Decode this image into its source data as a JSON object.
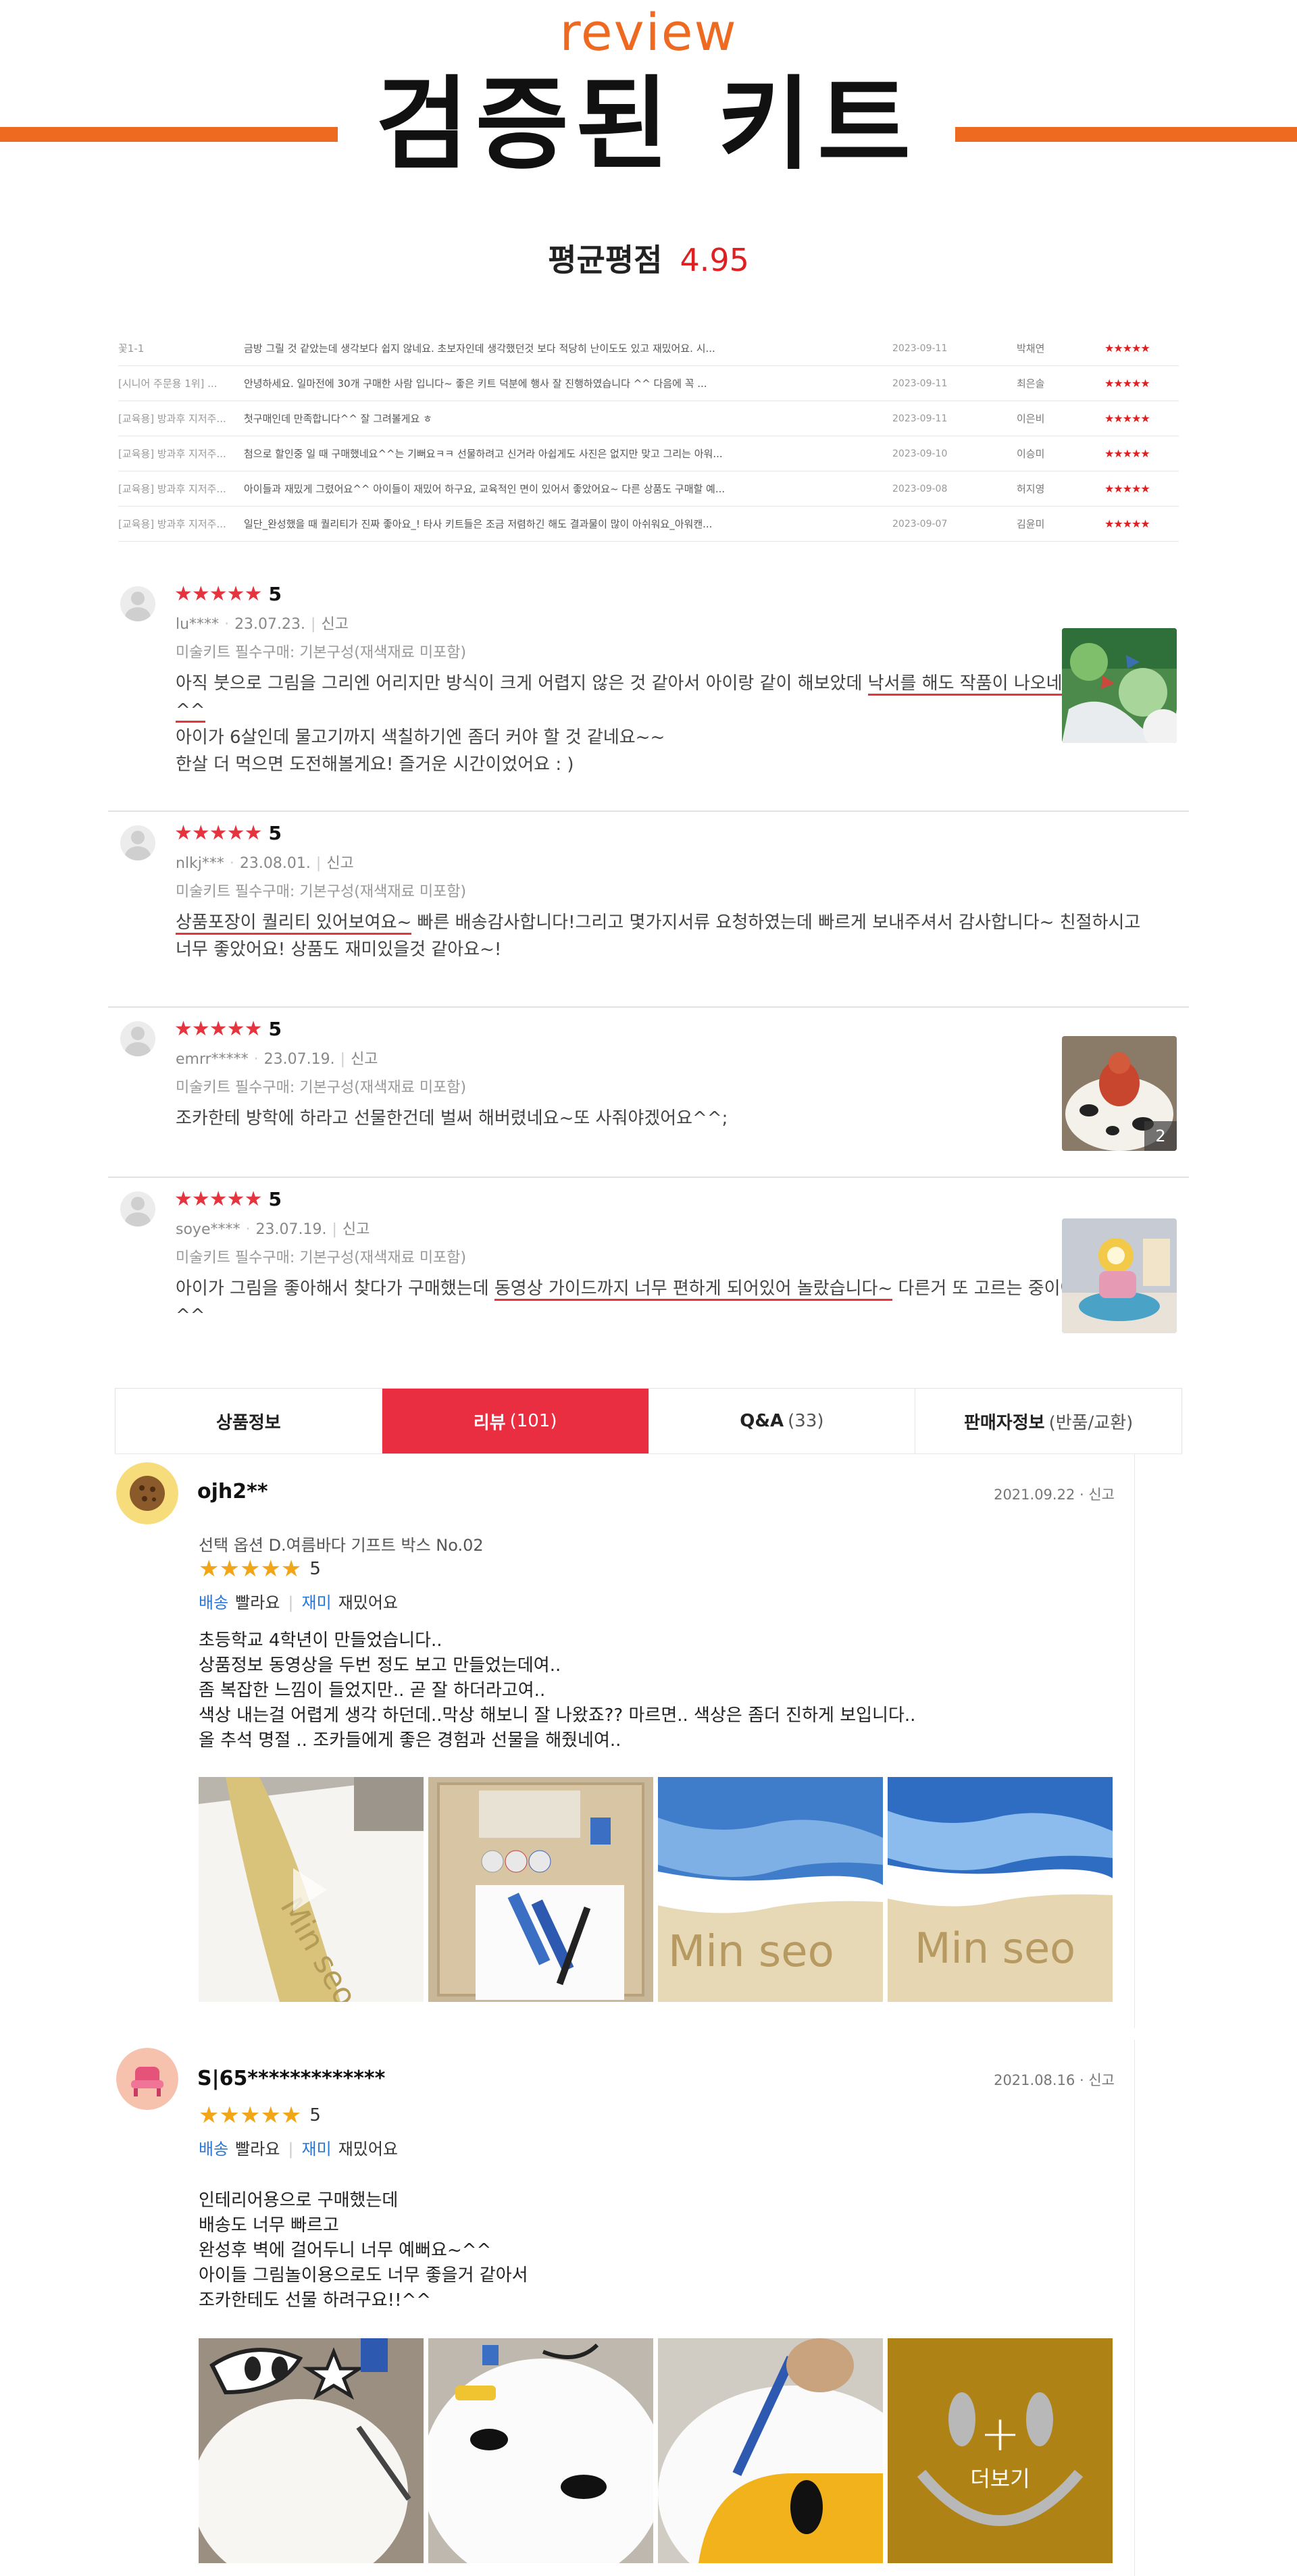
{
  "hero": {
    "eyebrow": "review",
    "title": "검증된 키트",
    "avg_label": "평균평점",
    "avg_score": "4.95"
  },
  "mini_reviews": [
    {
      "option": "꽃1-1",
      "text": "금방 그릴 것 같았는데 생각보다 쉽지 않네요. 초보자인데 생각했던것 보다 적당히 난이도도 있고 재밌어요. 시...",
      "date": "2023-09-11",
      "author": "박채연",
      "stars": "★★★★★"
    },
    {
      "option": "[시니어 주문용 1위] ...",
      "text": "안녕하세요. 일마전에 30개 구매한 사람 입니다~ 좋은 키트 덕분에 행사 잘 진행하였습니다 ^^ 다음에 꼭 ...",
      "date": "2023-09-11",
      "author": "최은솔",
      "stars": "★★★★★"
    },
    {
      "option": "[교육용] 방과후 지저주...",
      "text": "첫구매인데 만족합니다^^ 잘 그려볼게요 ㅎ",
      "date": "2023-09-11",
      "author": "이은비",
      "stars": "★★★★★"
    },
    {
      "option": "[교육용] 방과후 지저주...",
      "text": "첨으로 할인중 일 때 구매했네요^^는 기뻐요ㅋㅋ 선물하려고 신거라 아쉽게도 사진은 없지만 맞고 그리는 아워...",
      "date": "2023-09-10",
      "author": "이승미",
      "stars": "★★★★★"
    },
    {
      "option": "[교육용] 방과후 지저주...",
      "text": "아이들과 재밌게 그렸어요^^ 아이들이 재밌어 하구요, 교육적인 면이 있어서 좋았어요~ 다른 상품도 구매할 예...",
      "date": "2023-09-08",
      "author": "허지영",
      "stars": "★★★★★"
    },
    {
      "option": "[교육용] 방과후 지저주...",
      "text": "일단_완성했을 때 퀄리티가 진짜 좋아요_! 타사 키트들은 조금 저렴하긴 해도 결과물이 많이 아쉬워요_아워캔...",
      "date": "2023-09-07",
      "author": "김윤미",
      "stars": "★★★★★"
    }
  ],
  "reviews_a": [
    {
      "stars": "★★★★★",
      "score": "5",
      "user": "lu****",
      "date": "23.07.23.",
      "report": "신고",
      "option": "미술키트 필수구매: 기본구성(재색재료 미포함)",
      "pre": "아직 붓으로 그림을 그리엔 어리지만 방식이 크게 어렵지 않은 것 같아서 아이랑 같이 해보았데 ",
      "hl": "낙서를 해도 작품이 나오네요 ^^",
      "post": "",
      "lines": [
        "아이가 6살인데 물고기까지 색칠하기엔 좀더 커야 할 것 같네요~~",
        "한살 더 먹으면 도전해볼게요! 즐거운 시간이었어요 : )"
      ]
    },
    {
      "stars": "★★★★★",
      "score": "5",
      "user": "nlkj***",
      "date": "23.08.01.",
      "report": "신고",
      "option": "미술키트 필수구매: 기본구성(재색재료 미포함)",
      "pre": "",
      "hl": "상품포장이 퀄리티 있어보여요~",
      "post": " 빠른 배송감사합니다!그리고 몇가지서류 요청하였는데 빠르게 보내주셔서 감사합니다~ 친절하시고 너무 좋았어요! 상품도 재미있을것 같아요~!",
      "lines": []
    },
    {
      "stars": "★★★★★",
      "score": "5",
      "user": "emrr*****",
      "date": "23.07.19.",
      "report": "신고",
      "option": "미술키트 필수구매: 기본구성(재색재료 미포함)",
      "pre": "조카한테 방학에 하라고 선물한건데 벌써 해버렸네요~또 사줘야겠어요^^;",
      "hl": "",
      "post": "",
      "lines": [],
      "photo_count": "2"
    },
    {
      "stars": "★★★★★",
      "score": "5",
      "user": "soye****",
      "date": "23.07.19.",
      "report": "신고",
      "option": "미술키트 필수구매: 기본구성(재색재료 미포함)",
      "pre": "아이가 그림을 좋아해서 찾다가 구매했는데 ",
      "hl": "동영상 가이드까지 너무 편하게 되어있어 놀랐습니다~",
      "post": " 다른거 또 고르는 중이에요^^",
      "lines": []
    }
  ],
  "tabs": [
    {
      "label": "상품정보",
      "count": ""
    },
    {
      "label": "리뷰",
      "count": "(101)"
    },
    {
      "label": "Q&A",
      "count": "(33)"
    },
    {
      "label": "판매자정보",
      "count": "(반품/교환)"
    }
  ],
  "reviews_b": [
    {
      "user": "ojh2**",
      "date": "2021.09.22",
      "report": "신고",
      "option": "선택 옵션 D.여름바다 기프트 박스 No.02",
      "stars": "★★★★★",
      "score": "5",
      "tag1_key": "배송",
      "tag1_val": "빨라요",
      "tag2_key": "재미",
      "tag2_val": "재밌어요",
      "lines": [
        "초등학교 4학년이 만들었습니다..",
        "상품정보 동영상을 두번 정도 보고 만들었는데여..",
        "좀 복잡한 느낌이 들었지만.. 곧 잘 하더라고여..",
        "색상 내는걸 어렵게 생각 하던데..막상 해보니 잘 나왔죠?? 마르면.. 색상은 좀더 진하게 보입니다..",
        "올 추석 명절 .. 조카들에게 좋은 경험과 선물을 해줬네여.."
      ]
    },
    {
      "user": "S|65*************",
      "date": "2021.08.16",
      "report": "신고",
      "option": "",
      "stars": "★★★★★",
      "score": "5",
      "tag1_key": "배송",
      "tag1_val": "빨라요",
      "tag2_key": "재미",
      "tag2_val": "재밌어요",
      "lines": [
        "인테리어용으로 구매했는데",
        "배송도 너무 빠르고",
        "완성후 벽에 걸어두니 너무 예뻐요~^^",
        "아이들 그림놀이용으로도 너무 좋을거 같아서",
        "조카한테도 선물 하려구요!!^^"
      ],
      "more_label": "더보기"
    }
  ],
  "colors": {
    "accent_orange": "#ee6a20",
    "accent_red": "#e5343e",
    "tab_active": "#ea2e42",
    "star_gold": "#f2a516",
    "link_blue": "#2a78d6"
  }
}
